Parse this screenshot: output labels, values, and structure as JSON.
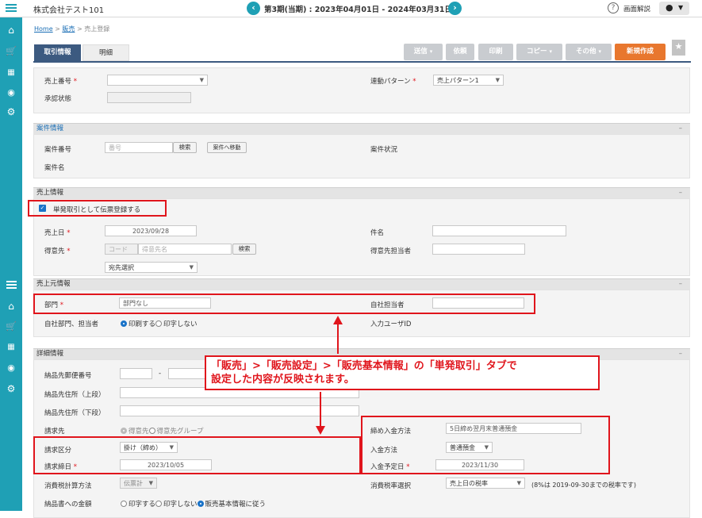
{
  "topbar": {
    "company": "株式会社テスト101",
    "period": "第3期(当期) : 2023年04月01日 - 2024年03月31日",
    "help_label": "画面解説",
    "prev_icon": "chevron-left-icon",
    "next_icon": "chevron-right-icon"
  },
  "breadcrumb": {
    "home": "Home",
    "sep1": ">",
    "sales": "販売",
    "sep2": ">",
    "current": "売上登録"
  },
  "tabs": {
    "tab1": "取引情報",
    "tab2": "明細"
  },
  "toolbar": {
    "send": "送信",
    "request": "依頼",
    "print": "印刷",
    "copy": "コピー",
    "other": "その他",
    "new": "新規作成"
  },
  "top_form": {
    "sales_no_label": "売上番号",
    "approval_label": "承認状態",
    "link_pattern_label": "連動パターン",
    "link_pattern_value": "売上パターン1"
  },
  "project": {
    "header": "案件情報",
    "no_label": "案件番号",
    "no_placeholder": "番号",
    "search": "検索",
    "goto": "案件へ移動",
    "status_label": "案件状況",
    "name_label": "案件名"
  },
  "sales_info": {
    "header": "売上情報",
    "checkbox_label": "単発取引として伝票登録する",
    "date_label": "売上日",
    "date_value": "2023/09/28",
    "subject_label": "件名",
    "customer_label": "得意先",
    "code_placeholder": "コード",
    "customer_name_placeholder": "得意先名",
    "customer_search": "検索",
    "address_select": "宛先選択",
    "customer_person_label": "得意先担当者"
  },
  "source_info": {
    "header": "売上元情報",
    "dept_label": "部門",
    "dept_value": "部門なし",
    "staff_label": "自社担当者",
    "print_label": "自社部門、担当者",
    "print_on": "印刷する",
    "print_off": "印字しない",
    "input_user_label": "入力ユーザID"
  },
  "detail": {
    "header": "詳細情報",
    "zip_label": "納品先郵便番号",
    "zip_dash": "-",
    "addr1_label": "納品先住所（上段）",
    "addr2_label": "納品先住所（下段）",
    "billing_label": "請求先",
    "billing_opt1": "得意先",
    "billing_opt2": "得意先グループ",
    "billing_type_label": "請求区分",
    "billing_type_value": "掛け（締め）",
    "closing_date_label": "請求締日",
    "closing_date_value": "2023/10/05",
    "tax_calc_label": "消費税計算方法",
    "tax_calc_value": "伝票計",
    "amount_label": "納品書への金額",
    "amount_opt1": "印字する",
    "amount_opt2": "印字しない",
    "amount_opt3": "販売基本情報に従う",
    "payment_method_label": "締め入金方法",
    "payment_method_value": "5日締め翌月末普通預金",
    "payment_type_label": "入金方法",
    "payment_type_value": "普通預金",
    "payment_date_label": "入金予定日",
    "payment_date_value": "2023/11/30",
    "tax_rate_label": "消費税率選択",
    "tax_rate_value": "売上日の税率",
    "tax_rate_note": "(8%は 2019-09-30までの税率です)"
  },
  "callout": {
    "line1": "「販売」>「販売設定」>「販売基本情報」の「単発取引」タブで",
    "line2": "設定した内容が反映されます。"
  },
  "colors": {
    "teal": "#1fa0b5",
    "red": "#e0151c",
    "orange": "#e8772e",
    "tab_blue": "#3c5a80"
  }
}
